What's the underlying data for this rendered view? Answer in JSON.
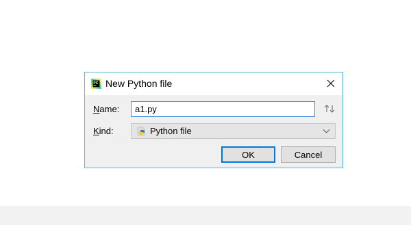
{
  "dialog": {
    "title": "New Python file",
    "app_icon": "pycharm-icon",
    "close_icon": "close-icon"
  },
  "form": {
    "name_label_mnemonic": "N",
    "name_label_rest": "ame:",
    "name_value": "a1.py",
    "sort_icon": "sort-arrows-icon",
    "kind_label_mnemonic": "K",
    "kind_label_rest": "ind:",
    "kind_value": "Python file",
    "kind_icon": "python-file-icon",
    "kind_dropdown_icon": "chevron-down-icon"
  },
  "buttons": {
    "ok_label": "OK",
    "cancel_label": "Cancel"
  },
  "colors": {
    "dialog_border": "#58b4d8",
    "input_focus_border": "#3d8fd6",
    "default_button_border": "#0078d7"
  }
}
